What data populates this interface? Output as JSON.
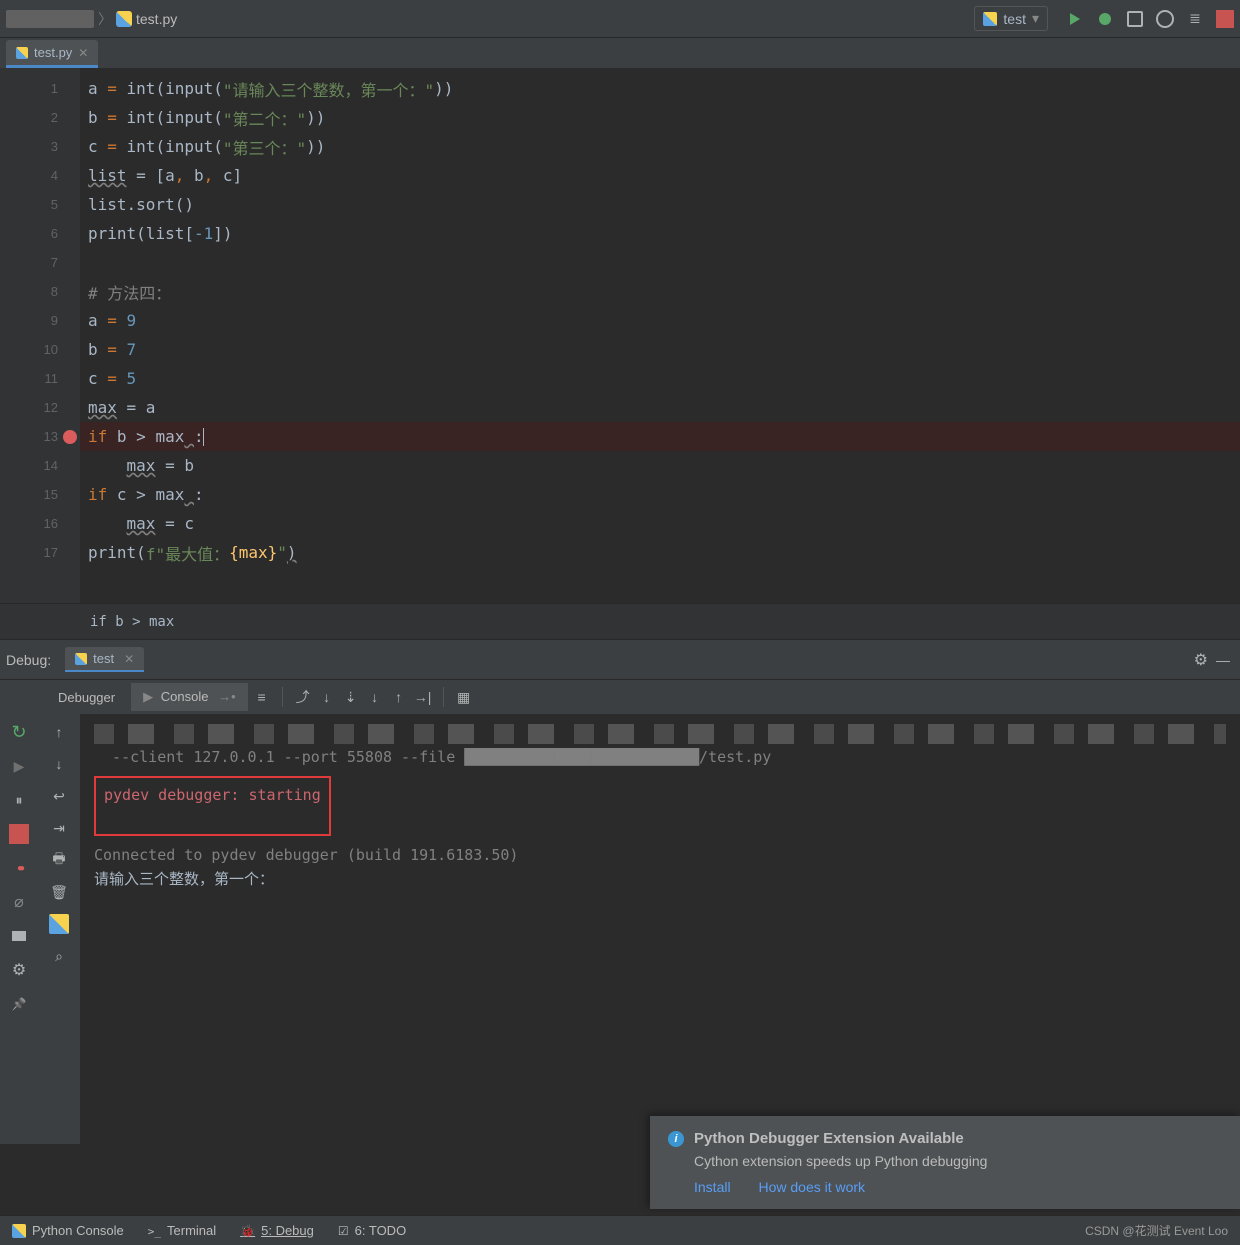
{
  "breadcrumb": {
    "project": "████",
    "file": "test.py"
  },
  "run_config": {
    "selected": "test"
  },
  "tabs": [
    {
      "label": "test.py",
      "active": true
    }
  ],
  "editor": {
    "lines": [
      {
        "n": 1,
        "tokens": [
          {
            "t": "a ",
            "c": "var"
          },
          {
            "t": "= ",
            "c": "kw"
          },
          {
            "t": "int",
            "c": "fn"
          },
          {
            "t": "(",
            "c": "var"
          },
          {
            "t": "input",
            "c": "fn"
          },
          {
            "t": "(",
            "c": "var"
          },
          {
            "t": "\"请输入三个整数，第一个：\"",
            "c": "str"
          },
          {
            "t": "))",
            "c": "var"
          }
        ]
      },
      {
        "n": 2,
        "tokens": [
          {
            "t": "b ",
            "c": "var"
          },
          {
            "t": "= ",
            "c": "kw"
          },
          {
            "t": "int",
            "c": "fn"
          },
          {
            "t": "(",
            "c": "var"
          },
          {
            "t": "input",
            "c": "fn"
          },
          {
            "t": "(",
            "c": "var"
          },
          {
            "t": "\"第二个：\"",
            "c": "str"
          },
          {
            "t": "))",
            "c": "var"
          }
        ]
      },
      {
        "n": 3,
        "tokens": [
          {
            "t": "c ",
            "c": "var"
          },
          {
            "t": "= ",
            "c": "kw"
          },
          {
            "t": "int",
            "c": "fn"
          },
          {
            "t": "(",
            "c": "var"
          },
          {
            "t": "input",
            "c": "fn"
          },
          {
            "t": "(",
            "c": "var"
          },
          {
            "t": "\"第三个：\"",
            "c": "str"
          },
          {
            "t": "))",
            "c": "var"
          }
        ]
      },
      {
        "n": 4,
        "tokens": [
          {
            "t": "list",
            "c": "warn"
          },
          {
            "t": " = [a",
            "c": "var"
          },
          {
            "t": ", ",
            "c": "kw"
          },
          {
            "t": "b",
            "c": "var"
          },
          {
            "t": ", ",
            "c": "kw"
          },
          {
            "t": "c]",
            "c": "var"
          }
        ]
      },
      {
        "n": 5,
        "tokens": [
          {
            "t": "list.sort()",
            "c": "var"
          }
        ]
      },
      {
        "n": 6,
        "tokens": [
          {
            "t": "print",
            "c": "fn"
          },
          {
            "t": "(list[",
            "c": "var"
          },
          {
            "t": "-1",
            "c": "num"
          },
          {
            "t": "])",
            "c": "var"
          }
        ]
      },
      {
        "n": 7,
        "tokens": []
      },
      {
        "n": 8,
        "tokens": [
          {
            "t": "# 方法四：",
            "c": "cmt"
          }
        ]
      },
      {
        "n": 9,
        "tokens": [
          {
            "t": "a ",
            "c": "var"
          },
          {
            "t": "= ",
            "c": "kw"
          },
          {
            "t": "9",
            "c": "num"
          }
        ]
      },
      {
        "n": 10,
        "tokens": [
          {
            "t": "b ",
            "c": "var"
          },
          {
            "t": "= ",
            "c": "kw"
          },
          {
            "t": "7",
            "c": "num"
          }
        ]
      },
      {
        "n": 11,
        "tokens": [
          {
            "t": "c ",
            "c": "var"
          },
          {
            "t": "= ",
            "c": "kw"
          },
          {
            "t": "5",
            "c": "num"
          }
        ]
      },
      {
        "n": 12,
        "tokens": [
          {
            "t": "max",
            "c": "warn"
          },
          {
            "t": " = a",
            "c": "var"
          }
        ]
      },
      {
        "n": 13,
        "bp": true,
        "hl": true,
        "tokens": [
          {
            "t": "if ",
            "c": "kw"
          },
          {
            "t": "b > max",
            "c": "var"
          },
          {
            "t": " ",
            "c": "warn"
          },
          {
            "t": ":",
            "c": "var"
          }
        ],
        "cursor": true
      },
      {
        "n": 14,
        "tokens": [
          {
            "t": "    ",
            "c": "var"
          },
          {
            "t": "max",
            "c": "warn"
          },
          {
            "t": " = b",
            "c": "var"
          }
        ]
      },
      {
        "n": 15,
        "tokens": [
          {
            "t": "if ",
            "c": "kw"
          },
          {
            "t": "c > max",
            "c": "var"
          },
          {
            "t": " ",
            "c": "warn"
          },
          {
            "t": ":",
            "c": "var"
          }
        ]
      },
      {
        "n": 16,
        "tokens": [
          {
            "t": "    ",
            "c": "var"
          },
          {
            "t": "max",
            "c": "warn"
          },
          {
            "t": " = c",
            "c": "var"
          }
        ]
      },
      {
        "n": 17,
        "tokens": [
          {
            "t": "print",
            "c": "fn"
          },
          {
            "t": "(",
            "c": "var"
          },
          {
            "t": "f\"最大值：",
            "c": "str"
          },
          {
            "t": "{max}",
            "c": "id"
          },
          {
            "t": "\"",
            "c": "str"
          },
          {
            "t": ")",
            "c": "warn"
          }
        ]
      }
    ],
    "context": "if b > max"
  },
  "debug_panel": {
    "label": "Debug:",
    "tab": "test",
    "tabs": {
      "debugger": "Debugger",
      "console": "Console"
    },
    "console": {
      "line_args": "  --client 127.0.0.1 --port 55808 --file ██████████████████████████/test.py",
      "starting": "pydev debugger: starting",
      "connected": "Connected to pydev debugger (build 191.6183.50)",
      "prompt": "请输入三个整数，第一个："
    }
  },
  "notification": {
    "title": "Python Debugger Extension Available",
    "body": "Cython extension speeds up Python debugging",
    "link_install": "Install",
    "link_how": "How does it work"
  },
  "bottom_tools": {
    "console": "Python Console",
    "terminal": "Terminal",
    "debug": "5: Debug",
    "todo": "6: TODO",
    "watermark": "CSDN @花测试   Event Loo"
  }
}
